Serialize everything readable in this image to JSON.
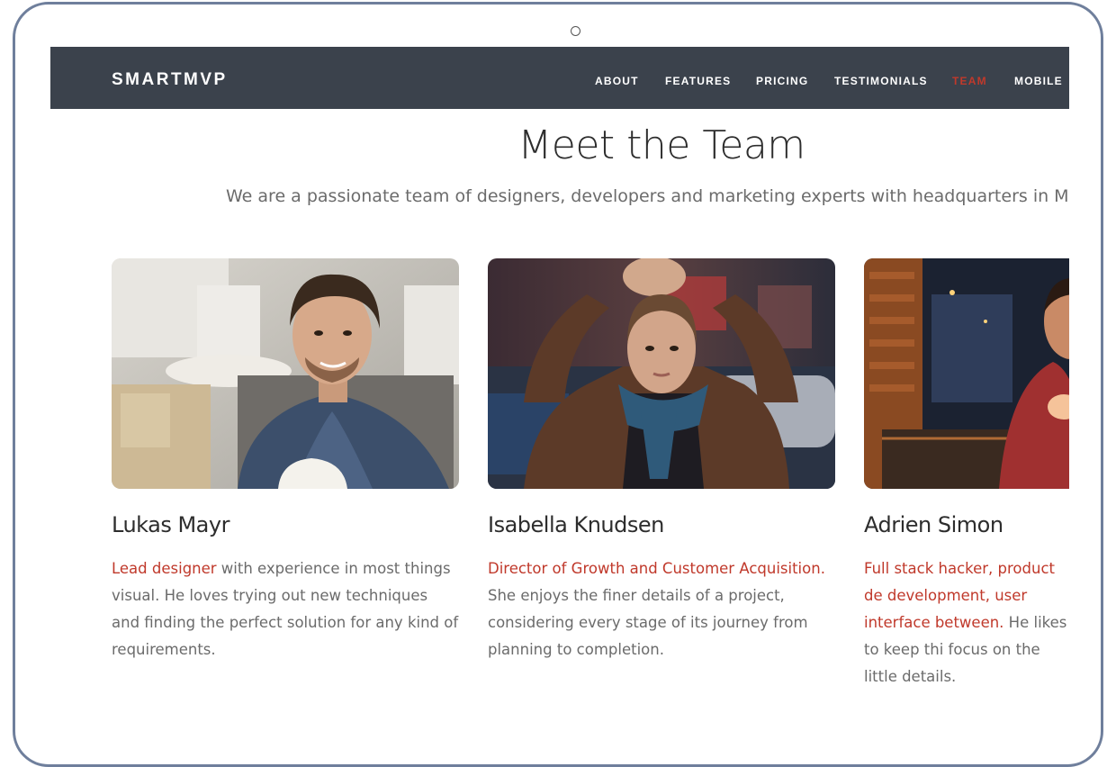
{
  "navbar": {
    "brand": "SMARTMVP",
    "items": [
      {
        "label": "ABOUT",
        "active": false
      },
      {
        "label": "FEATURES",
        "active": false
      },
      {
        "label": "PRICING",
        "active": false
      },
      {
        "label": "TESTIMONIALS",
        "active": false
      },
      {
        "label": "TEAM",
        "active": true
      },
      {
        "label": "MOBILE",
        "active": false
      }
    ]
  },
  "section": {
    "title": "Meet the Team",
    "subtitle": "We are a passionate team of designers, developers and marketing experts with headquarters in Melbour"
  },
  "team": [
    {
      "name": "Lukas Mayr",
      "role": "Lead designer",
      "bio": " with experience in most things visual. He loves trying out new techniques and finding the perfect solution for any kind of requirements."
    },
    {
      "name": "Isabella Knudsen",
      "role": "Director of Growth and Customer Acquisition.",
      "bio": " She enjoys the finer details of a project, considering every stage of its journey from planning to completion."
    },
    {
      "name": "Adrien Simon",
      "role": "Full stack hacker, product de development, user interface between.",
      "bio": " He likes to keep thi focus on the little details."
    }
  ],
  "colors": {
    "nav_bg": "#3b424c",
    "accent": "#c0392b",
    "device_frame": "#6f7f9c"
  }
}
